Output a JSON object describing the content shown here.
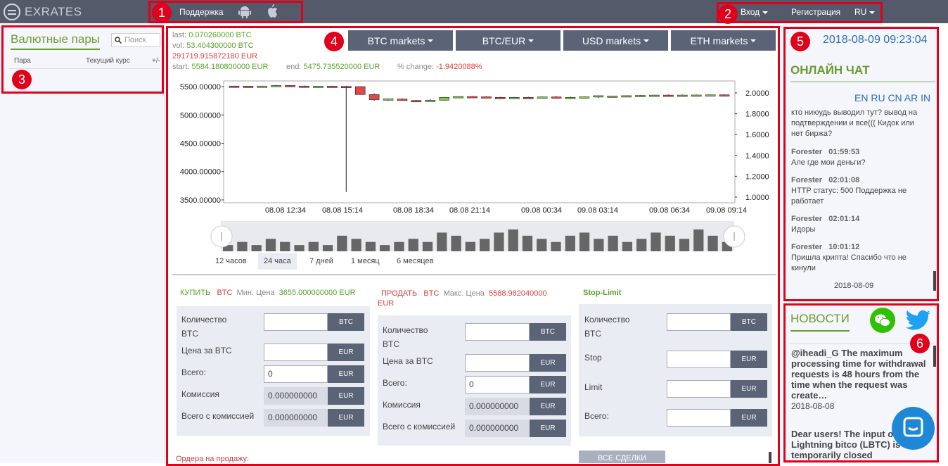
{
  "header": {
    "logo": "EXRATES",
    "support": "Поддержка",
    "login": "Вход",
    "register": "Регистрация",
    "lang": "RU"
  },
  "pairs": {
    "title": "Валютные пары",
    "search_placeholder": "Поиск",
    "col_pair": "Пара",
    "col_rate": "Текущий курс",
    "col_change": "+/-"
  },
  "stats": {
    "last_label": "last:",
    "last": "0.070260000 BTC",
    "vol_label": "vol:",
    "vol": "53.404300000 BTC",
    "vol_eur": "291719.915872180 EUR",
    "start_label": "start:",
    "start": "5584.180800000 EUR",
    "end_label": "end:",
    "end": "5475.735520000 EUR",
    "change_label": "% change:",
    "change": "-1.9420088%"
  },
  "markets": [
    "BTC markets",
    "BTC/EUR",
    "USD markets",
    "ETH markets"
  ],
  "chart_data": {
    "type": "candlestick",
    "y_left_ticks": [
      "5500.00000",
      "5000.00000",
      "4500.00000",
      "4000.00000",
      "3500.00000"
    ],
    "y_right_ticks": [
      "2.0000",
      "1.8000",
      "1.6000",
      "1.4000",
      "1.2000",
      "1.0000"
    ],
    "x_ticks": [
      "08.08 12:34",
      "08.08 15:14",
      "08.08 18:34",
      "08.08 21:14",
      "09.08 00:34",
      "09.08 03:14",
      "09.08 06:34",
      "09.08 09:14"
    ],
    "ylim": [
      3450,
      5600
    ],
    "candles": [
      [
        5510,
        5515,
        5505,
        5508
      ],
      [
        5508,
        5512,
        5500,
        5505
      ],
      [
        5505,
        5515,
        5500,
        5510
      ],
      [
        5510,
        5530,
        5505,
        5520
      ],
      [
        5520,
        5525,
        5505,
        5510
      ],
      [
        5510,
        5520,
        5500,
        5505
      ],
      [
        5505,
        5515,
        5500,
        5508
      ],
      [
        5508,
        5515,
        5500,
        5505
      ],
      [
        5505,
        5515,
        3640,
        5500
      ],
      [
        5500,
        5505,
        5360,
        5360
      ],
      [
        5360,
        5380,
        5250,
        5270
      ],
      [
        5270,
        5290,
        5250,
        5285
      ],
      [
        5280,
        5290,
        5250,
        5255
      ],
      [
        5255,
        5265,
        5240,
        5250
      ],
      [
        5250,
        5280,
        5240,
        5260
      ],
      [
        5260,
        5320,
        5250,
        5310
      ],
      [
        5310,
        5330,
        5300,
        5325
      ],
      [
        5325,
        5335,
        5310,
        5320
      ],
      [
        5320,
        5330,
        5300,
        5310
      ],
      [
        5310,
        5320,
        5300,
        5300
      ],
      [
        5300,
        5320,
        5290,
        5310
      ],
      [
        5310,
        5320,
        5300,
        5305
      ],
      [
        5305,
        5325,
        5300,
        5318
      ],
      [
        5318,
        5330,
        5300,
        5302
      ],
      [
        5305,
        5325,
        5300,
        5310
      ],
      [
        5310,
        5325,
        5300,
        5320
      ],
      [
        5320,
        5330,
        5300,
        5340
      ],
      [
        5330,
        5340,
        5310,
        5335
      ],
      [
        5335,
        5345,
        5320,
        5340
      ],
      [
        5340,
        5350,
        5330,
        5345
      ],
      [
        5345,
        5355,
        5335,
        5350
      ],
      [
        5350,
        5360,
        5340,
        5348
      ],
      [
        5348,
        5360,
        5340,
        5350
      ],
      [
        5350,
        5360,
        5340,
        5352
      ],
      [
        5352,
        5360,
        5345,
        5355
      ],
      [
        5355,
        5365,
        5345,
        5352
      ]
    ],
    "volumes": [
      2,
      3,
      2,
      4,
      3,
      2,
      3,
      2,
      5,
      4,
      3,
      2,
      3,
      4,
      3,
      6,
      5,
      3,
      4,
      6,
      7,
      5,
      4,
      3,
      5,
      6,
      4,
      5,
      3,
      4,
      6,
      5,
      4,
      7,
      5,
      3
    ]
  },
  "timeframes": [
    "12 часов",
    "24 часа",
    "7 дней",
    "1 месяц",
    "6 месяцев"
  ],
  "buy": {
    "title": "КУПИТЬ",
    "cur": "BTC",
    "min_label": "Мин. Цена",
    "min": "3655.000000000 EUR",
    "qty": "Количество BTC",
    "price": "Цена за BTC",
    "total": "Всего:",
    "fee": "Комиссия",
    "total_fee": "Всего с комиссией",
    "total_val": "0",
    "fee_val": "0.000000000",
    "total_fee_val": "0.000000000"
  },
  "sell": {
    "title": "ПРОДАТЬ",
    "cur": "BTC",
    "max_label": "Макс. Цена",
    "max": "5588.982040000",
    "max_cur": "EUR",
    "qty": "Количество BTC",
    "price": "Цена за BTC",
    "total": "Всего:",
    "fee": "Комиссия",
    "total_fee": "Всего с комиссией",
    "total_val": "0",
    "fee_val": "0.000000000",
    "total_fee_val": "0.000000000"
  },
  "stop": {
    "title": "Stop-Limit",
    "qty": "Количество BTC",
    "stop": "Stop",
    "limit": "Limit",
    "total": "Всего:"
  },
  "units": {
    "btc": "BTC",
    "eur": "EUR"
  },
  "orders_sell": "Ордера на продажу:",
  "all_deals": "ВСЕ СДЕЛКИ",
  "chat": {
    "datetime": "2018-08-09 09:23:04",
    "title": "ОНЛАЙН ЧАТ",
    "langs": "EN RU CN AR IN",
    "messages": [
      {
        "user": "",
        "time": "",
        "text": "кто ниюудь выводил тут? вывод на подтверждении и все((( Кидок или нет биржа?"
      },
      {
        "user": "Forester",
        "time": "01:59:53",
        "text": "Але где мои деньги?"
      },
      {
        "user": "Forester",
        "time": "02:01:08",
        "text": "HTTP статус: 500 Поддержка не работает"
      },
      {
        "user": "Forester",
        "time": "02:01:14",
        "text": "Идоры"
      },
      {
        "user": "Forester",
        "time": "10:01:12",
        "text": "Пришла крипта! Спасибо что не кинули"
      }
    ],
    "date_sep": "2018-08-09"
  },
  "news": {
    "title": "НОВОСТИ",
    "items": [
      {
        "text": "@iheadi_G The maximum processing time for withdrawal requests is 48 hours from the time when the request was create…",
        "date": "2018-08-08"
      },
      {
        "text": "Dear users! The input output of Lightning bitco (LBTC) is temporarily closed",
        "date": ""
      }
    ]
  },
  "annotations": [
    "1",
    "2",
    "3",
    "4",
    "5",
    "6"
  ],
  "colors": {
    "accent_green": "#6a9a2e",
    "red_box": "#e0001b",
    "header_bg": "#555a6b",
    "button_bg": "#5b6377"
  }
}
